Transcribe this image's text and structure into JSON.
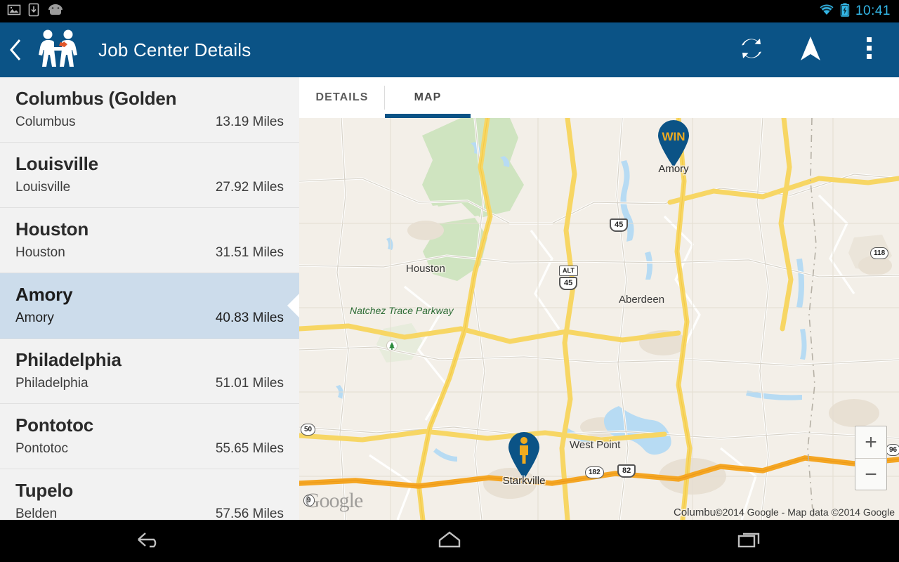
{
  "status_bar": {
    "icons": [
      "image-icon",
      "download-icon",
      "android-icon"
    ],
    "wifi_icon": "wifi-icon",
    "battery_icon": "battery-charging-icon",
    "clock": "10:41",
    "accent_color": "#33b5e5"
  },
  "action_bar": {
    "back_icon": "back-chevron-icon",
    "app_logo_icon": "handshake-people-icon",
    "title": "Job Center Details",
    "background_color": "#0b5386",
    "actions": [
      {
        "icon": "refresh-icon",
        "name": "refresh-button"
      },
      {
        "icon": "navigation-arrow-icon",
        "name": "navigate-button"
      },
      {
        "icon": "overflow-menu-icon",
        "name": "overflow-menu-button"
      }
    ]
  },
  "list": {
    "items": [
      {
        "title": "Columbus (Golden",
        "subtitle": "Columbus",
        "distance": "13.19 Miles",
        "selected": false
      },
      {
        "title": "Louisville",
        "subtitle": "Louisville",
        "distance": "27.92 Miles",
        "selected": false
      },
      {
        "title": "Houston",
        "subtitle": "Houston",
        "distance": "31.51 Miles",
        "selected": false
      },
      {
        "title": "Amory",
        "subtitle": "Amory",
        "distance": "40.83 Miles",
        "selected": true
      },
      {
        "title": "Philadelphia",
        "subtitle": "Philadelphia",
        "distance": "51.01 Miles",
        "selected": false
      },
      {
        "title": "Pontotoc",
        "subtitle": "Pontotoc",
        "distance": "55.65 Miles",
        "selected": false
      },
      {
        "title": "Tupelo",
        "subtitle": "Belden",
        "distance": "57.56 Miles",
        "selected": false
      }
    ],
    "selected_background": "#ccdceb"
  },
  "tabs": [
    {
      "label": "DETAILS",
      "active": false
    },
    {
      "label": "MAP",
      "active": true
    }
  ],
  "map": {
    "pins": [
      {
        "label": "Amory",
        "badge": "WIN",
        "type": "win-pin",
        "color": "#0b5386",
        "badge_color": "#f0ab1e"
      },
      {
        "label": "Starkville",
        "badge": "",
        "type": "person-pin",
        "color": "#0b5386",
        "badge_color": "#f0ab1e"
      }
    ],
    "place_labels": [
      "Houston",
      "Aberdeen",
      "West Point",
      "Columbus"
    ],
    "park_label": "Natchez Trace Parkway",
    "road_shields": [
      "45",
      "ALT",
      "45",
      "118",
      "50",
      "96",
      "182",
      "82",
      "9"
    ],
    "zoom_in_label": "+",
    "zoom_out_label": "−",
    "attribution": "©2014 Google - Map data ©2014 Google",
    "watermark": "Google",
    "base_color": "#f3efe8"
  },
  "nav_bar": {
    "buttons": [
      {
        "icon": "back-icon",
        "name": "nav-back-button"
      },
      {
        "icon": "home-icon",
        "name": "nav-home-button"
      },
      {
        "icon": "recents-icon",
        "name": "nav-recents-button"
      }
    ]
  }
}
